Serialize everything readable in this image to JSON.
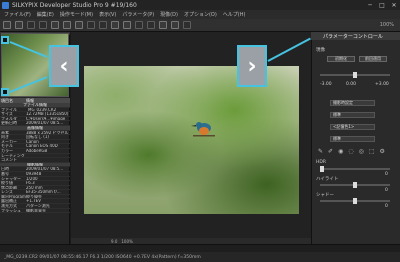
{
  "window": {
    "title": "SILKYPIX Developer Studio Pro 9",
    "counter": "#19/160",
    "min": "─",
    "max": "□",
    "close": "✕"
  },
  "menu": [
    "ファイル(F)",
    "編集(E)",
    "操作モード(M)",
    "表示(V)",
    "パラメータ(P)",
    "現像(D)",
    "オプション(O)",
    "ヘルプ(H)"
  ],
  "toolbar": {
    "zoom": "100%"
  },
  "info": {
    "header": [
      "項目名",
      "情報"
    ],
    "rows": [
      {
        "sec": "ファイル情報"
      },
      {
        "k": "ファイル",
        "v": "_MG_0239.CR2"
      },
      {
        "k": "サイズ",
        "v": "12.72MB (13351850)"
      },
      {
        "k": "フォルダ",
        "v": "C:¥Users¥...¥image"
      },
      {
        "k": "更新日時",
        "v": "2009/01/07 08:5..."
      },
      {
        "sec": "画像情報"
      },
      {
        "k": "画素",
        "v": "3888 x 2592 ピクセル"
      },
      {
        "k": "向き",
        "v": "回転なし (1)"
      },
      {
        "k": "メーカー",
        "v": "Canon"
      },
      {
        "k": "モデル",
        "v": "Canon EOS 40D"
      },
      {
        "k": "カラー",
        "v": "AdobeRGB"
      },
      {
        "k": "レーティング",
        "v": ""
      },
      {
        "k": "コメント",
        "v": ""
      },
      {
        "sec": "撮影情報"
      },
      {
        "k": "日時",
        "v": "2009/01/07 08:5..."
      },
      {
        "k": "番号",
        "v": "093948"
      },
      {
        "k": "シャッター",
        "v": "1/200"
      },
      {
        "k": "絞り値",
        "v": "F6.3"
      },
      {
        "k": "焦点距離",
        "v": "250 mm"
      },
      {
        "k": "レンズ",
        "v": "EF35-350mm f/..."
      },
      {
        "k": "露出Program",
        "v": "絞り優先"
      },
      {
        "k": "露出補正",
        "v": "+1.7EV"
      },
      {
        "k": "測光方式",
        "v": "パターン測光"
      },
      {
        "k": "フラッシュ",
        "v": "撮影非発光"
      }
    ]
  },
  "nav": {
    "prev": "‹",
    "next": "›"
  },
  "view": {
    "zoom_label": "9.0",
    "fit": "100%"
  },
  "right": {
    "title": "パラメーターコントロール",
    "preset_label": "現像",
    "btn_init": "初期化",
    "btn_reset": "前回適用",
    "exposure_value": "0.00",
    "exposure_min": "-3.00",
    "exposure_max": "+3.00",
    "wb": "撮影時設定",
    "tone": "標準",
    "color": "<記憶色1>",
    "sharp": "標準",
    "hdr_label": "HDR",
    "highlight_label": "ハイライト",
    "shadow_label": "シャドー",
    "hdr_value": "0",
    "highlight_value": "0",
    "shadow_value": "0"
  },
  "status": {
    "text": "_MG_0239.CR2 09/01/07 08:55:46.17 F6.3 1/200 ISO640 +0.7EV 4x(Pattern) f=350mm"
  }
}
